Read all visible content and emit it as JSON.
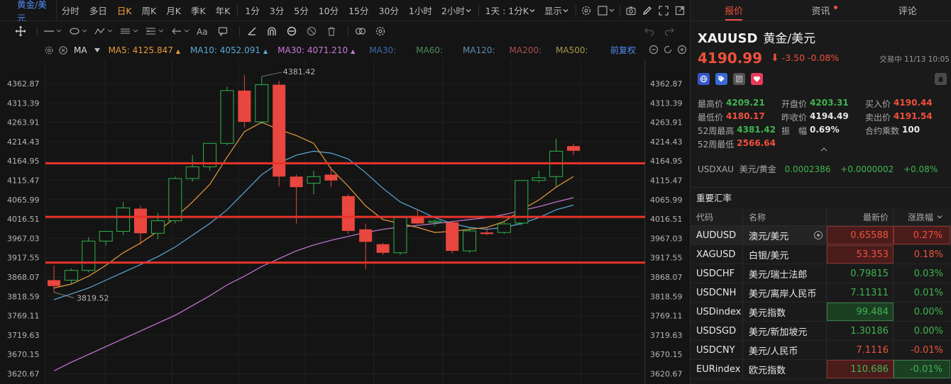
{
  "toolbar": {
    "symbol": "黄金/美元",
    "timeframes": [
      {
        "label": "分时",
        "active": false
      },
      {
        "label": "多日",
        "active": false
      },
      {
        "label": "日K",
        "active": true
      },
      {
        "label": "周K",
        "active": false
      },
      {
        "label": "月K",
        "active": false
      },
      {
        "label": "季K",
        "active": false
      },
      {
        "label": "年K",
        "active": false
      },
      {
        "label": "1分",
        "active": false
      },
      {
        "label": "3分",
        "active": false
      },
      {
        "label": "5分",
        "active": false
      },
      {
        "label": "10分",
        "active": false
      },
      {
        "label": "15分",
        "active": false
      },
      {
        "label": "30分",
        "active": false
      },
      {
        "label": "1小时",
        "active": false
      }
    ],
    "dropdown_2h": "2小时",
    "dropdown_1d": "1天 : 1分K",
    "dropdown_display": "显示"
  },
  "ma_legend": {
    "ma_label": "MA",
    "ma5": "MA5:  4125.847",
    "ma10": "MA10:  4052.091",
    "ma30": "MA30:  4071.210",
    "ma30b": "MA30:",
    "ma60": "MA60:",
    "ma120": "MA120:",
    "ma200": "MA200:",
    "ma500": "MA500:",
    "adjust": "前复权",
    "colors": {
      "ma5": "#e89a3c",
      "ma10": "#59a9d6",
      "ma30": "#c87ad8",
      "ma30b": "#3a6aa8",
      "ma60": "#4e8a5a",
      "ma120": "#5c8fa8",
      "ma200": "#a84e4e",
      "ma500": "#a89a4e"
    }
  },
  "chart_data": {
    "type": "candlestick",
    "y_ticks": [
      "4362.87",
      "4313.39",
      "4263.91",
      "4214.43",
      "4164.95",
      "4115.47",
      "4065.99",
      "4016.51",
      "3967.03",
      "3917.55",
      "3868.07",
      "3818.59",
      "3769.11",
      "3719.63",
      "3670.15",
      "3620.67"
    ],
    "ylim": [
      3620.67,
      4362.87
    ],
    "annotations": {
      "high": "4381.42",
      "low": "3819.52"
    },
    "candles": [
      {
        "o": 3860,
        "h": 3898,
        "l": 3829,
        "c": 3845
      },
      {
        "o": 3860,
        "h": 3890,
        "l": 3848,
        "c": 3885
      },
      {
        "o": 3885,
        "h": 3970,
        "l": 3880,
        "c": 3960
      },
      {
        "o": 3960,
        "h": 3985,
        "l": 3948,
        "c": 3985
      },
      {
        "o": 3985,
        "h": 4060,
        "l": 3975,
        "c": 4045
      },
      {
        "o": 4043,
        "h": 4050,
        "l": 3950,
        "c": 3980
      },
      {
        "o": 3980,
        "h": 4032,
        "l": 3965,
        "c": 4012
      },
      {
        "o": 4012,
        "h": 4125,
        "l": 4005,
        "c": 4120
      },
      {
        "o": 4120,
        "h": 4180,
        "l": 4112,
        "c": 4150
      },
      {
        "o": 4150,
        "h": 4210,
        "l": 4140,
        "c": 4210
      },
      {
        "o": 4210,
        "h": 4355,
        "l": 4205,
        "c": 4345
      },
      {
        "o": 4345,
        "h": 4385,
        "l": 4250,
        "c": 4265
      },
      {
        "o": 4265,
        "h": 4381,
        "l": 4260,
        "c": 4360
      },
      {
        "o": 4360,
        "h": 4370,
        "l": 4100,
        "c": 4125
      },
      {
        "o": 4125,
        "h": 4130,
        "l": 4005,
        "c": 4098
      },
      {
        "o": 4108,
        "h": 4140,
        "l": 4080,
        "c": 4125
      },
      {
        "o": 4130,
        "h": 4150,
        "l": 4098,
        "c": 4115
      },
      {
        "o": 4075,
        "h": 4080,
        "l": 3978,
        "c": 3986
      },
      {
        "o": 3990,
        "h": 4005,
        "l": 3888,
        "c": 3958
      },
      {
        "o": 3952,
        "h": 3955,
        "l": 3925,
        "c": 3930
      },
      {
        "o": 3930,
        "h": 4025,
        "l": 3925,
        "c": 4020
      },
      {
        "o": 4020,
        "h": 4040,
        "l": 4002,
        "c": 4005
      },
      {
        "o": 4008,
        "h": 4015,
        "l": 3998,
        "c": 4011
      },
      {
        "o": 4008,
        "h": 4012,
        "l": 3928,
        "c": 3935
      },
      {
        "o": 3935,
        "h": 3995,
        "l": 3930,
        "c": 3986
      },
      {
        "o": 3982,
        "h": 3995,
        "l": 3975,
        "c": 3978
      },
      {
        "o": 3982,
        "h": 4010,
        "l": 3978,
        "c": 4004
      },
      {
        "o": 4006,
        "h": 4115,
        "l": 4000,
        "c": 4115
      },
      {
        "o": 4115,
        "h": 4140,
        "l": 4110,
        "c": 4122
      },
      {
        "o": 4125,
        "h": 4222,
        "l": 4100,
        "c": 4190
      },
      {
        "o": 4203,
        "h": 4209,
        "l": 4180,
        "c": 4191
      }
    ],
    "ma5": [
      3840,
      3850,
      3870,
      3898,
      3930,
      3955,
      3985,
      4020,
      4060,
      4105,
      4175,
      4240,
      4264,
      4245,
      4230,
      4210,
      4145,
      4100,
      4050,
      4015,
      4005,
      3995,
      3982,
      3985,
      3990,
      3995,
      4010,
      4040,
      4065,
      4098,
      4125
    ],
    "ma10": [
      3810,
      3825,
      3840,
      3860,
      3880,
      3900,
      3920,
      3945,
      3975,
      4005,
      4040,
      4085,
      4130,
      4160,
      4180,
      4190,
      4185,
      4170,
      4135,
      4095,
      4060,
      4040,
      4020,
      4005,
      3995,
      3990,
      3995,
      4005,
      4020,
      4040,
      4052
    ],
    "ma30": [
      3628,
      3650,
      3670,
      3690,
      3710,
      3730,
      3750,
      3770,
      3795,
      3820,
      3848,
      3870,
      3895,
      3915,
      3935,
      3950,
      3962,
      3972,
      3982,
      3990,
      3996,
      4000,
      4005,
      4010,
      4015,
      4020,
      4028,
      4038,
      4048,
      4060,
      4071
    ],
    "support_lines": [
      4159,
      4022,
      3905
    ]
  },
  "panel": {
    "tabs": [
      {
        "label": "报价",
        "active": true
      },
      {
        "label": "资讯",
        "active": false,
        "dot": true
      },
      {
        "label": "评论",
        "active": false
      }
    ],
    "code": "XAUUSD",
    "name": "黄金/美元",
    "price": "4190.99",
    "change": "-3.50",
    "change_pct": "-0.08%",
    "status": "交易中 11/13 10:05",
    "stats": [
      [
        {
          "k": "最高价",
          "v": "4209.21",
          "c": "up"
        },
        {
          "k": "开盘价",
          "v": "4203.31",
          "c": "up"
        },
        {
          "k": "买入价",
          "v": "4190.44",
          "c": "dn"
        }
      ],
      [
        {
          "k": "最低价",
          "v": "4180.17",
          "c": "dn"
        },
        {
          "k": "昨收价",
          "v": "4194.49",
          "c": "wh"
        },
        {
          "k": "卖出价",
          "v": "4191.54",
          "c": "dn"
        }
      ],
      [
        {
          "k": "52周最高",
          "v": "4381.42",
          "c": "up"
        },
        {
          "k": "振　幅",
          "v": "0.69%",
          "c": "wh"
        },
        {
          "k": "合约乘数",
          "v": "100",
          "c": "wh"
        }
      ],
      [
        {
          "k": "52周最低",
          "v": "2566.64",
          "c": "dn"
        }
      ]
    ],
    "xau": {
      "code": "USDXAU",
      "name": "美元/黄金",
      "price": "0.0002386",
      "change": "+0.0000002",
      "pct": "+0.08%"
    },
    "rates_title": "重要汇率",
    "rates_head": {
      "code": "代码",
      "name": "名称",
      "price": "最新价",
      "chg": "涨跌幅"
    },
    "rates": [
      {
        "code": "AUDUSD",
        "name": "澳元/美元",
        "price": "0.65588",
        "chg": "0.27%",
        "dir": "dn",
        "hl_price": "red",
        "hl_chg": "red",
        "sel": true
      },
      {
        "code": "XAGUSD",
        "name": "白银/美元",
        "price": "53.353",
        "chg": "0.18%",
        "dir": "dn",
        "hl_price": "red",
        "hl_chg": "none"
      },
      {
        "code": "USDCHF",
        "name": "美元/瑞士法郎",
        "price": "0.79815",
        "chg": "0.03%",
        "dir": "up",
        "hl_price": "none",
        "hl_chg": "none"
      },
      {
        "code": "USDCNH",
        "name": "美元/离岸人民币",
        "price": "7.11311",
        "chg": "0.01%",
        "dir": "up",
        "hl_price": "none",
        "hl_chg": "none"
      },
      {
        "code": "USDindex",
        "name": "美元指数",
        "price": "99.484",
        "chg": "0.00%",
        "dir": "up",
        "hl_price": "green",
        "hl_chg": "none"
      },
      {
        "code": "USDSGD",
        "name": "美元/新加坡元",
        "price": "1.30186",
        "chg": "0.00%",
        "dir": "up",
        "hl_price": "none",
        "hl_chg": "none"
      },
      {
        "code": "USDCNY",
        "name": "美元/人民币",
        "price": "7.1116",
        "chg": "-0.01%",
        "dir": "dn",
        "hl_price": "none",
        "hl_chg": "none"
      },
      {
        "code": "EURindex",
        "name": "欧元指数",
        "price": "110.686",
        "chg": "-0.01%",
        "dir": "up",
        "hl_price": "red",
        "hl_chg": "green"
      }
    ]
  }
}
